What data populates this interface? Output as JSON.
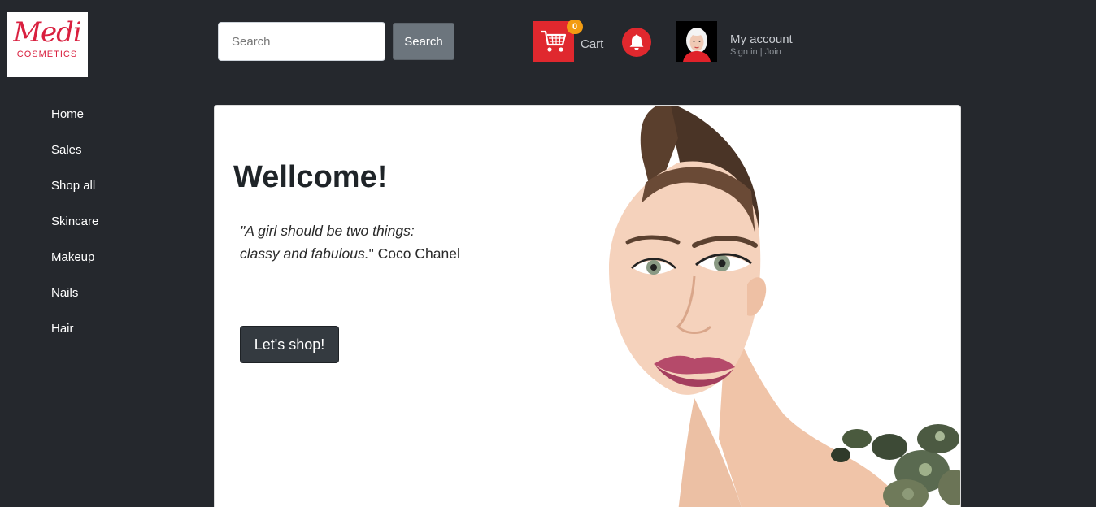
{
  "logo": {
    "script_text": "Medi",
    "sub_text": "COSMETICS",
    "brand_color": "#d9203f"
  },
  "search": {
    "placeholder": "Search",
    "value": "",
    "button_label": "Search"
  },
  "cart": {
    "count": "0",
    "label": "Cart",
    "icon": "shopping-cart-icon",
    "accent": "#e0282e",
    "badge_color": "#f39c12"
  },
  "notifications": {
    "icon": "bell-icon"
  },
  "account": {
    "title": "My account",
    "sign_in": "Sign in",
    "separator": " | ",
    "join": "Join"
  },
  "sidebar": {
    "items": [
      {
        "label": "Home"
      },
      {
        "label": "Sales"
      },
      {
        "label": "Shop all"
      },
      {
        "label": "Skincare"
      },
      {
        "label": "Makeup"
      },
      {
        "label": "Nails"
      },
      {
        "label": "Hair"
      }
    ]
  },
  "hero": {
    "title": "Wellcome!",
    "quote_line1": "\"A girl should be two things:",
    "quote_line2": "classy and fabulous.",
    "quote_close": "\"",
    "quote_author": " Coco Chanel",
    "button_label": "Let's shop!"
  },
  "colors": {
    "background": "#25282d",
    "card": "#ffffff",
    "primary_button": "#343a40",
    "secondary_button": "#6c757d"
  }
}
